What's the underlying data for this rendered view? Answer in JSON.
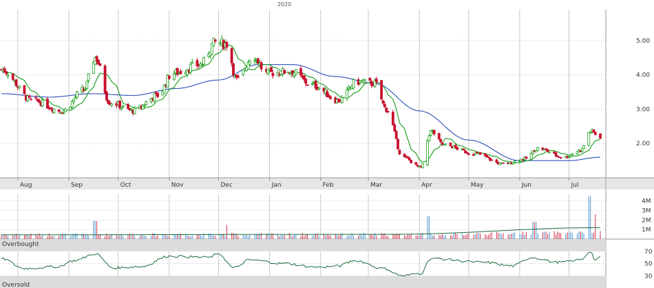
{
  "chart_data": {
    "type": "candlestick",
    "year_label": "2020",
    "colors": {
      "up": "#1a9e1a",
      "down": "#c8102e",
      "ma_short": "#139a13",
      "ma_long": "#2a4fb8",
      "volume_up": "#4a90d0",
      "volume_down": "#d0304a",
      "volume_avg": "#1b6b3a",
      "oscillator": "#1b6b3a",
      "band_fill": "#dcdcdc",
      "grid": "#c8c8c8",
      "axis_strip": "#e6e6e6"
    },
    "price_panel": {
      "y_ticks": [
        "5.00",
        "4.00",
        "3.00",
        "2.00"
      ],
      "y_tick_values": [
        5,
        4,
        3,
        2
      ],
      "ylim": [
        1.0,
        5.9
      ]
    },
    "months": [
      {
        "label": "Aug",
        "start": "2019-08-01"
      },
      {
        "label": "Sep",
        "start": "2019-09-01"
      },
      {
        "label": "Oct",
        "start": "2019-10-01"
      },
      {
        "label": "Nov",
        "start": "2019-11-01"
      },
      {
        "label": "Dec",
        "start": "2019-12-01"
      },
      {
        "label": "Jan",
        "start": "2020-01-01"
      },
      {
        "label": "Feb",
        "start": "2020-02-01"
      },
      {
        "label": "Mar",
        "start": "2020-03-01"
      },
      {
        "label": "Apr",
        "start": "2020-04-01"
      },
      {
        "label": "May",
        "start": "2020-05-01"
      },
      {
        "label": "Jun",
        "start": "2020-06-01"
      },
      {
        "label": "Jul",
        "start": "2020-07-01"
      }
    ],
    "date_range": [
      "2019-07-22",
      "2020-07-20"
    ],
    "price_anchors": [
      {
        "date": "2019-07-22",
        "close": 4.15
      },
      {
        "date": "2019-08-10",
        "close": 3.25
      },
      {
        "date": "2019-08-28",
        "close": 2.95
      },
      {
        "date": "2019-09-10",
        "close": 3.55
      },
      {
        "date": "2019-09-17",
        "close": 4.5
      },
      {
        "date": "2019-09-26",
        "close": 3.2
      },
      {
        "date": "2019-10-10",
        "close": 2.95
      },
      {
        "date": "2019-10-25",
        "close": 3.4
      },
      {
        "date": "2019-11-03",
        "close": 4.05
      },
      {
        "date": "2019-11-20",
        "close": 4.3
      },
      {
        "date": "2019-11-29",
        "close": 4.95
      },
      {
        "date": "2019-12-06",
        "close": 4.9
      },
      {
        "date": "2019-12-12",
        "close": 3.85
      },
      {
        "date": "2019-12-22",
        "close": 4.55
      },
      {
        "date": "2019-12-30",
        "close": 4.05
      },
      {
        "date": "2020-01-14",
        "close": 4.1
      },
      {
        "date": "2020-01-27",
        "close": 3.7
      },
      {
        "date": "2020-02-12",
        "close": 3.25
      },
      {
        "date": "2020-02-23",
        "close": 3.8
      },
      {
        "date": "2020-03-05",
        "close": 3.75
      },
      {
        "date": "2020-03-12",
        "close": 3.0
      },
      {
        "date": "2020-03-22",
        "close": 1.6
      },
      {
        "date": "2020-04-02",
        "close": 1.3
      },
      {
        "date": "2020-04-08",
        "close": 2.35
      },
      {
        "date": "2020-04-16",
        "close": 1.95
      },
      {
        "date": "2020-05-05",
        "close": 1.7
      },
      {
        "date": "2020-05-22",
        "close": 1.4
      },
      {
        "date": "2020-06-04",
        "close": 1.55
      },
      {
        "date": "2020-06-12",
        "close": 1.85
      },
      {
        "date": "2020-06-28",
        "close": 1.6
      },
      {
        "date": "2020-07-08",
        "close": 1.8
      },
      {
        "date": "2020-07-14",
        "close": 2.35
      },
      {
        "date": "2020-07-20",
        "close": 2.2
      }
    ],
    "ma_long_anchors": [
      {
        "date": "2019-07-22",
        "value": 3.45
      },
      {
        "date": "2019-08-20",
        "value": 3.35
      },
      {
        "date": "2019-09-15",
        "value": 3.45
      },
      {
        "date": "2019-10-10",
        "value": 3.4
      },
      {
        "date": "2019-11-05",
        "value": 3.6
      },
      {
        "date": "2019-12-01",
        "value": 3.85
      },
      {
        "date": "2019-12-25",
        "value": 4.3
      },
      {
        "date": "2020-01-15",
        "value": 4.3
      },
      {
        "date": "2020-02-10",
        "value": 3.95
      },
      {
        "date": "2020-03-05",
        "value": 3.75
      },
      {
        "date": "2020-04-01",
        "value": 2.95
      },
      {
        "date": "2020-05-01",
        "value": 2.1
      },
      {
        "date": "2020-06-01",
        "value": 1.5
      },
      {
        "date": "2020-07-01",
        "value": 1.5
      },
      {
        "date": "2020-07-20",
        "value": 1.6
      }
    ],
    "volume_panel": {
      "y_ticks": [
        "4M",
        "3M",
        "2M",
        "1M"
      ],
      "y_tick_values": [
        4,
        3,
        2,
        1
      ],
      "ylim": [
        0,
        4.7
      ],
      "spikes": [
        {
          "date": "2019-09-17",
          "value": 1.9
        },
        {
          "date": "2019-12-07",
          "value": 1.5
        },
        {
          "date": "2020-04-06",
          "value": 2.4
        },
        {
          "date": "2020-06-10",
          "value": 1.8
        },
        {
          "date": "2020-07-13",
          "value": 4.5
        },
        {
          "date": "2020-07-18",
          "value": 2.6
        }
      ],
      "avg_anchors": [
        {
          "date": "2019-07-22",
          "value": 0.45
        },
        {
          "date": "2020-03-15",
          "value": 0.5
        },
        {
          "date": "2020-07-20",
          "value": 1.2
        }
      ]
    },
    "oscillator_panel": {
      "band_labels": [
        "Overbought",
        "Oversold"
      ],
      "y_ticks": [
        "70",
        "50",
        "30"
      ],
      "y_tick_values": [
        70,
        50,
        30
      ],
      "ylim": [
        10,
        90
      ],
      "anchors": [
        {
          "date": "2019-07-22",
          "value": 58
        },
        {
          "date": "2019-08-05",
          "value": 42
        },
        {
          "date": "2019-08-25",
          "value": 45
        },
        {
          "date": "2019-09-05",
          "value": 55
        },
        {
          "date": "2019-09-17",
          "value": 66
        },
        {
          "date": "2019-09-28",
          "value": 43
        },
        {
          "date": "2019-10-15",
          "value": 45
        },
        {
          "date": "2019-11-01",
          "value": 62
        },
        {
          "date": "2019-11-25",
          "value": 60
        },
        {
          "date": "2019-12-01",
          "value": 66
        },
        {
          "date": "2019-12-10",
          "value": 43
        },
        {
          "date": "2019-12-20",
          "value": 56
        },
        {
          "date": "2020-01-10",
          "value": 50
        },
        {
          "date": "2020-01-30",
          "value": 44
        },
        {
          "date": "2020-02-12",
          "value": 46
        },
        {
          "date": "2020-02-22",
          "value": 55
        },
        {
          "date": "2020-03-10",
          "value": 42
        },
        {
          "date": "2020-03-22",
          "value": 30
        },
        {
          "date": "2020-04-02",
          "value": 34
        },
        {
          "date": "2020-04-08",
          "value": 58
        },
        {
          "date": "2020-05-10",
          "value": 52
        },
        {
          "date": "2020-05-28",
          "value": 46
        },
        {
          "date": "2020-06-08",
          "value": 60
        },
        {
          "date": "2020-06-25",
          "value": 52
        },
        {
          "date": "2020-07-08",
          "value": 56
        },
        {
          "date": "2020-07-14",
          "value": 70
        },
        {
          "date": "2020-07-17",
          "value": 55
        },
        {
          "date": "2020-07-20",
          "value": 60
        }
      ]
    }
  }
}
